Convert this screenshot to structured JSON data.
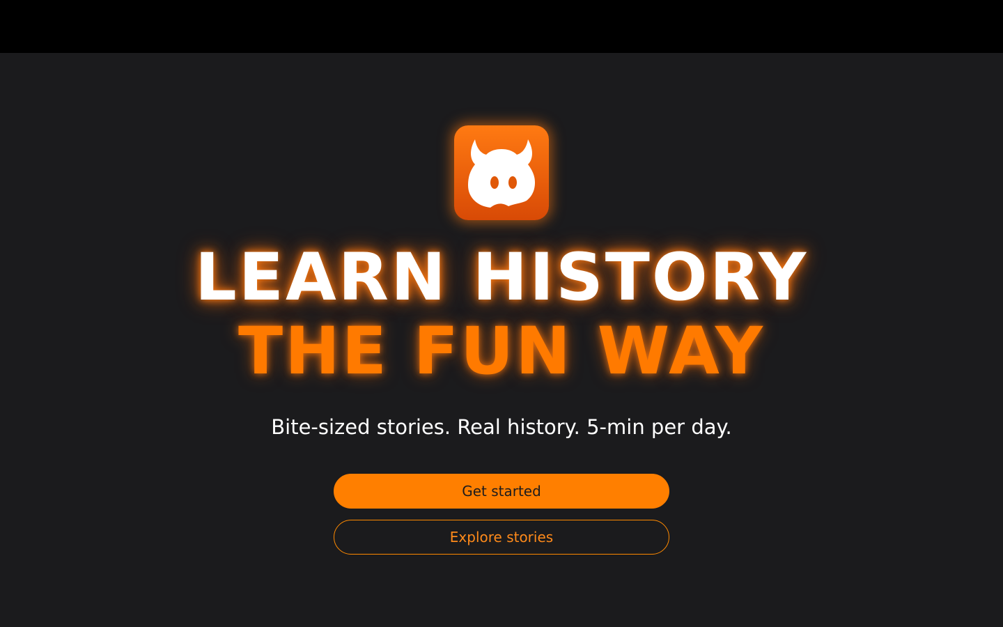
{
  "hero": {
    "logo_icon": "horned-mascot-icon",
    "headline_line1": "LEARN HISTORY",
    "headline_line2": "THE FUN WAY",
    "tagline": "Bite-sized stories. Real history. 5-min per day."
  },
  "actions": {
    "primary_label": "Get started",
    "secondary_label": "Explore stories"
  },
  "colors": {
    "background": "#1b1b1d",
    "topbar": "#000000",
    "accent": "#ff7f00",
    "headline_primary": "#ffffff",
    "headline_accent": "#ff7a00"
  }
}
